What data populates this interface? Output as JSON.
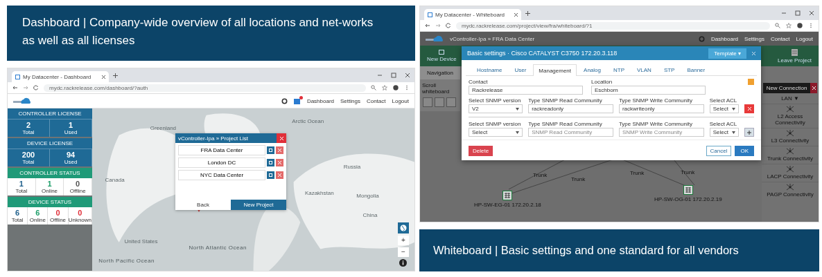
{
  "dashboard_panel": {
    "caption": "Dashboard | Company-wide overview of all locations and net-works as well as all licenses",
    "browser": {
      "tab_title": "My Datacenter - Dashboard",
      "url": "mydc.rackrelease.com/dashboard/?auth"
    },
    "nav": [
      "Dashboard",
      "Settings",
      "Contact",
      "Logout"
    ],
    "cards": [
      {
        "kind": "license",
        "title": "CONTROLLER LICENSE",
        "stats": [
          {
            "value": "2",
            "label": "Total"
          },
          {
            "value": "1",
            "label": "Used"
          }
        ]
      },
      {
        "kind": "license",
        "title": "DEVICE LICENSE",
        "stats": [
          {
            "value": "200",
            "label": "Total"
          },
          {
            "value": "94",
            "label": "Used"
          }
        ]
      },
      {
        "kind": "status",
        "title": "CONTROLLER STATUS",
        "stats": [
          {
            "value": "1",
            "label": "Total",
            "color": "#1f5f8b"
          },
          {
            "value": "1",
            "label": "Online",
            "color": "#1e9e6a"
          },
          {
            "value": "0",
            "label": "Offline",
            "color": "#555555"
          }
        ]
      },
      {
        "kind": "status",
        "title": "DEVICE STATUS",
        "stats": [
          {
            "value": "6",
            "label": "Total",
            "color": "#1f5f8b"
          },
          {
            "value": "6",
            "label": "Online",
            "color": "#1e9e6a"
          },
          {
            "value": "0",
            "label": "Offline",
            "color": "#e0303a"
          },
          {
            "value": "0",
            "label": "Unknown",
            "color": "#e0303a"
          }
        ]
      }
    ],
    "map_labels": [
      "Arctic Ocean",
      "Greenland",
      "Canada",
      "United States",
      "North Atlantic Ocean",
      "North Pacific Ocean",
      "Russia",
      "Mongolia",
      "China",
      "Kazakhstan"
    ],
    "project_list": {
      "title": "vController-Ipa » Project List",
      "projects": [
        "FRA Data Center",
        "London DC",
        "NYC Data Center"
      ],
      "back": "Back",
      "new_project": "New Project"
    },
    "zoom_controls": [
      "+",
      "−"
    ]
  },
  "whiteboard_panel": {
    "caption": "Whiteboard | Basic settings and one standard for all vendors",
    "browser": {
      "tab_title": "My Datacenter - Whiteboard",
      "url": "mydc.rackrelease.com/project/view/fra/whiteboard/?1"
    },
    "breadcrumb": "vController-Ipa » FRA Data Center",
    "nav": [
      "Dashboard",
      "Settings",
      "Contact",
      "Logout"
    ],
    "new_device": "New Device",
    "leave_project": "Leave Project",
    "navigation": "Navigation",
    "navigation_sub": "Scroll whiteboard",
    "new_connection": "New Connection",
    "lan": "LAN ▼",
    "connections": [
      "L2 Access Connectivity",
      "L3 Connectivity",
      "Trunk Connectivity",
      "LACP Connectivity",
      "PAGP Connectivity"
    ],
    "edge_labels": [
      "Trunk",
      "Trunk",
      "Trunk",
      "Trunk"
    ],
    "nodes": [
      "HP-SW-EG-01 172.20.2.18",
      "HP-SW-OG-01 172.20.2.19"
    ],
    "settings_dialog": {
      "title": "Basic settings · Cisco CATALYST C3750 172.20.3.118",
      "template": "Template ▾",
      "tabs": [
        {
          "label": "Hostname",
          "selected": false
        },
        {
          "label": "User",
          "selected": false
        },
        {
          "label": "Management",
          "selected": true
        },
        {
          "label": "Analog",
          "selected": false
        },
        {
          "label": "NTP",
          "selected": false
        },
        {
          "label": "VLAN",
          "selected": false
        },
        {
          "label": "STP",
          "selected": false
        },
        {
          "label": "Banner",
          "selected": false
        }
      ],
      "contact": {
        "label": "Contact",
        "value": "Rackrelease"
      },
      "location": {
        "label": "Location",
        "value": "Eschborn"
      },
      "snmp_rows": [
        {
          "kind": "remove",
          "version_label": "Select SNMP version",
          "version": "V2",
          "read_label": "Type SNMP Read Community",
          "read_value": "rackreadonly",
          "write_label": "Type SNMP Write Community",
          "write_value": "rackwriteonly",
          "acl_label": "Select ACL",
          "acl": "Select"
        },
        {
          "kind": "add",
          "version_label": "Select SNMP version",
          "version": "Select",
          "read_label": "Type SNMP Read Community",
          "read_placeholder": "SNMP Read Community",
          "write_label": "Type SNMP Write Community",
          "write_placeholder": "SNMP Write Community",
          "acl_label": "Select ACL",
          "acl": "Select"
        }
      ],
      "delete": "Delete",
      "cancel": "Cancel",
      "ok": "OK"
    }
  }
}
